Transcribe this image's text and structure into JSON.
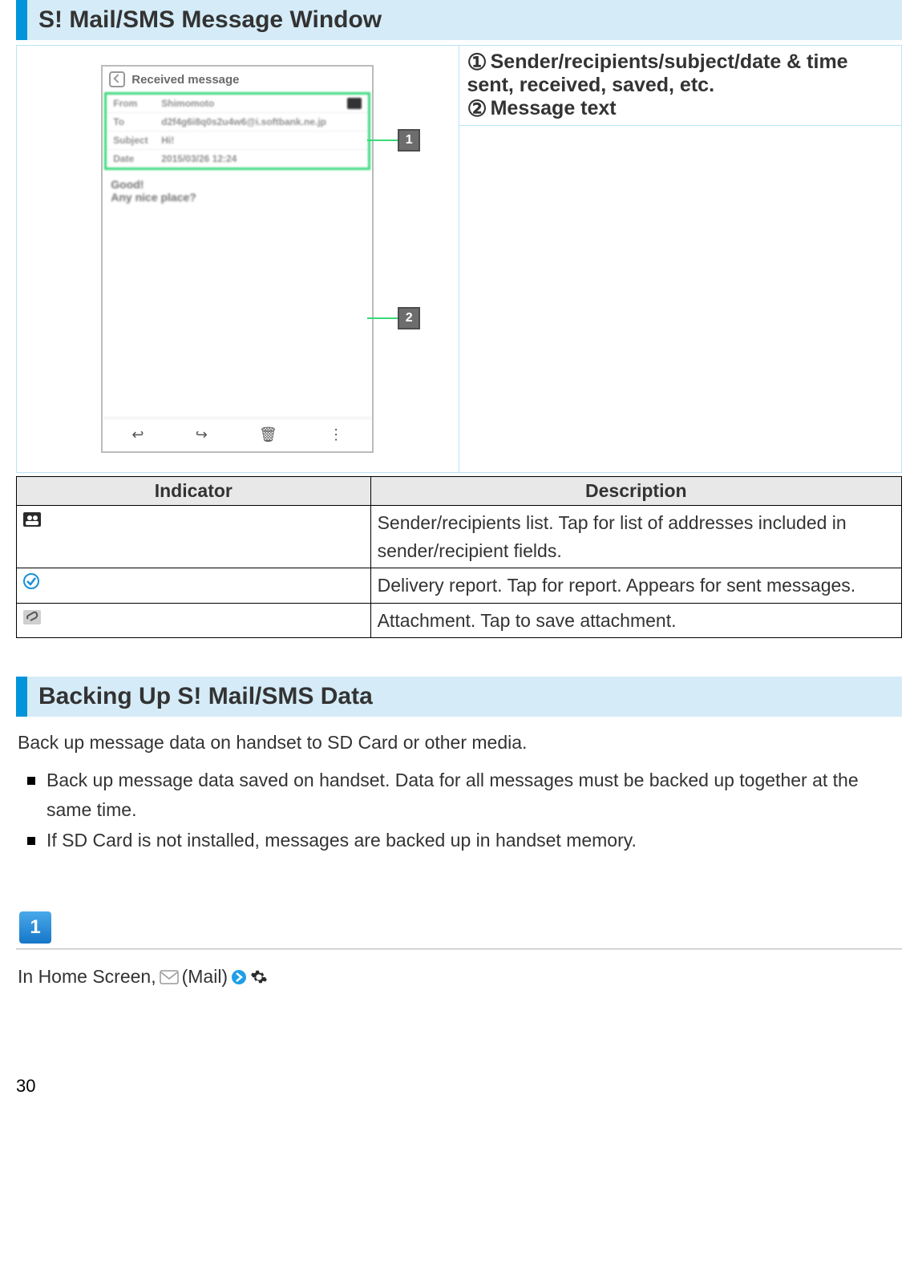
{
  "heading1": "S! Mail/SMS Message Window",
  "legend": {
    "item1": "Sender/recipients/subject/date & time sent, received, saved, etc.",
    "item2": "Message text"
  },
  "phone": {
    "title": "Received message",
    "from_label": "From",
    "from_value": "Shimomoto",
    "to_label": "To",
    "to_value": "d2f4g6i8q0s2u4w6@i.softbank.ne.jp",
    "subject_label": "Subject",
    "subject_value": "Hi!",
    "date_label": "Date",
    "date_value": "2015/03/26 12:24",
    "body_line1": "Good!",
    "body_line2": "Any nice place?"
  },
  "ind_table": {
    "header_indicator": "Indicator",
    "header_description": "Description",
    "rows": [
      {
        "icon": "people",
        "desc": "Sender/recipients list. Tap for list of addresses included in sender/recipient fields."
      },
      {
        "icon": "check",
        "desc": "Delivery report. Tap for report. Appears for sent messages."
      },
      {
        "icon": "clip",
        "desc": "Attachment. Tap to save attachment."
      }
    ]
  },
  "heading2": "Backing Up S! Mail/SMS Data",
  "backup_intro": "Back up message data on handset to SD Card or other media.",
  "backup_bullets": [
    "Back up message data saved on handset. Data for all messages must be backed up together at the same time.",
    "If SD Card is not installed, messages are backed up in handset memory."
  ],
  "step": {
    "num": "1",
    "pre": "In Home Screen, ",
    "mail_label": "(Mail)"
  },
  "page_number": "30"
}
